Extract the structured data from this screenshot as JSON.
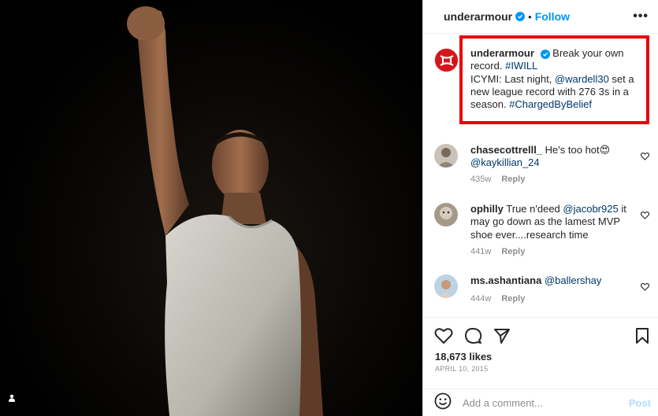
{
  "header": {
    "username": "underarmour",
    "separator": "•",
    "follow_label": "Follow",
    "more_label": "•••"
  },
  "caption": {
    "username": "underarmour",
    "line1": "Break your own record.",
    "hashtag1": "#IWILL",
    "part2": "ICYMI: Last night,",
    "mention": "@wardell30",
    "part3": "set a new league record with 276 3s in a season.",
    "hashtag2": "#ChargedByBelief"
  },
  "comments": [
    {
      "username": "chasecottrelll_",
      "text": "He's too hot😍",
      "mention": "@kaykillian_24",
      "text_after": "",
      "time": "435w",
      "reply": "Reply"
    },
    {
      "username": "ophilly",
      "text": "True n'deed",
      "mention": "@jacobr925",
      "text_after": "it may go down as the lamest MVP shoe ever....research time",
      "time": "441w",
      "reply": "Reply"
    },
    {
      "username": "ms.ashantiana",
      "text": "",
      "mention": "@ballershay",
      "text_after": "",
      "time": "444w",
      "reply": "Reply"
    }
  ],
  "post": {
    "likes": "18,673 likes",
    "date": "APRIL 10, 2015"
  },
  "add_comment": {
    "placeholder": "Add a comment...",
    "post_label": "Post"
  },
  "colors": {
    "accent": "#0095f6",
    "highlight_box": "#e8000b",
    "link": "#00376b",
    "brand": "#d7141a"
  },
  "icons": [
    "verified-icon",
    "more-icon",
    "heart-icon",
    "comment-icon",
    "share-icon",
    "bookmark-icon",
    "emoji-icon",
    "user-tag-icon"
  ]
}
